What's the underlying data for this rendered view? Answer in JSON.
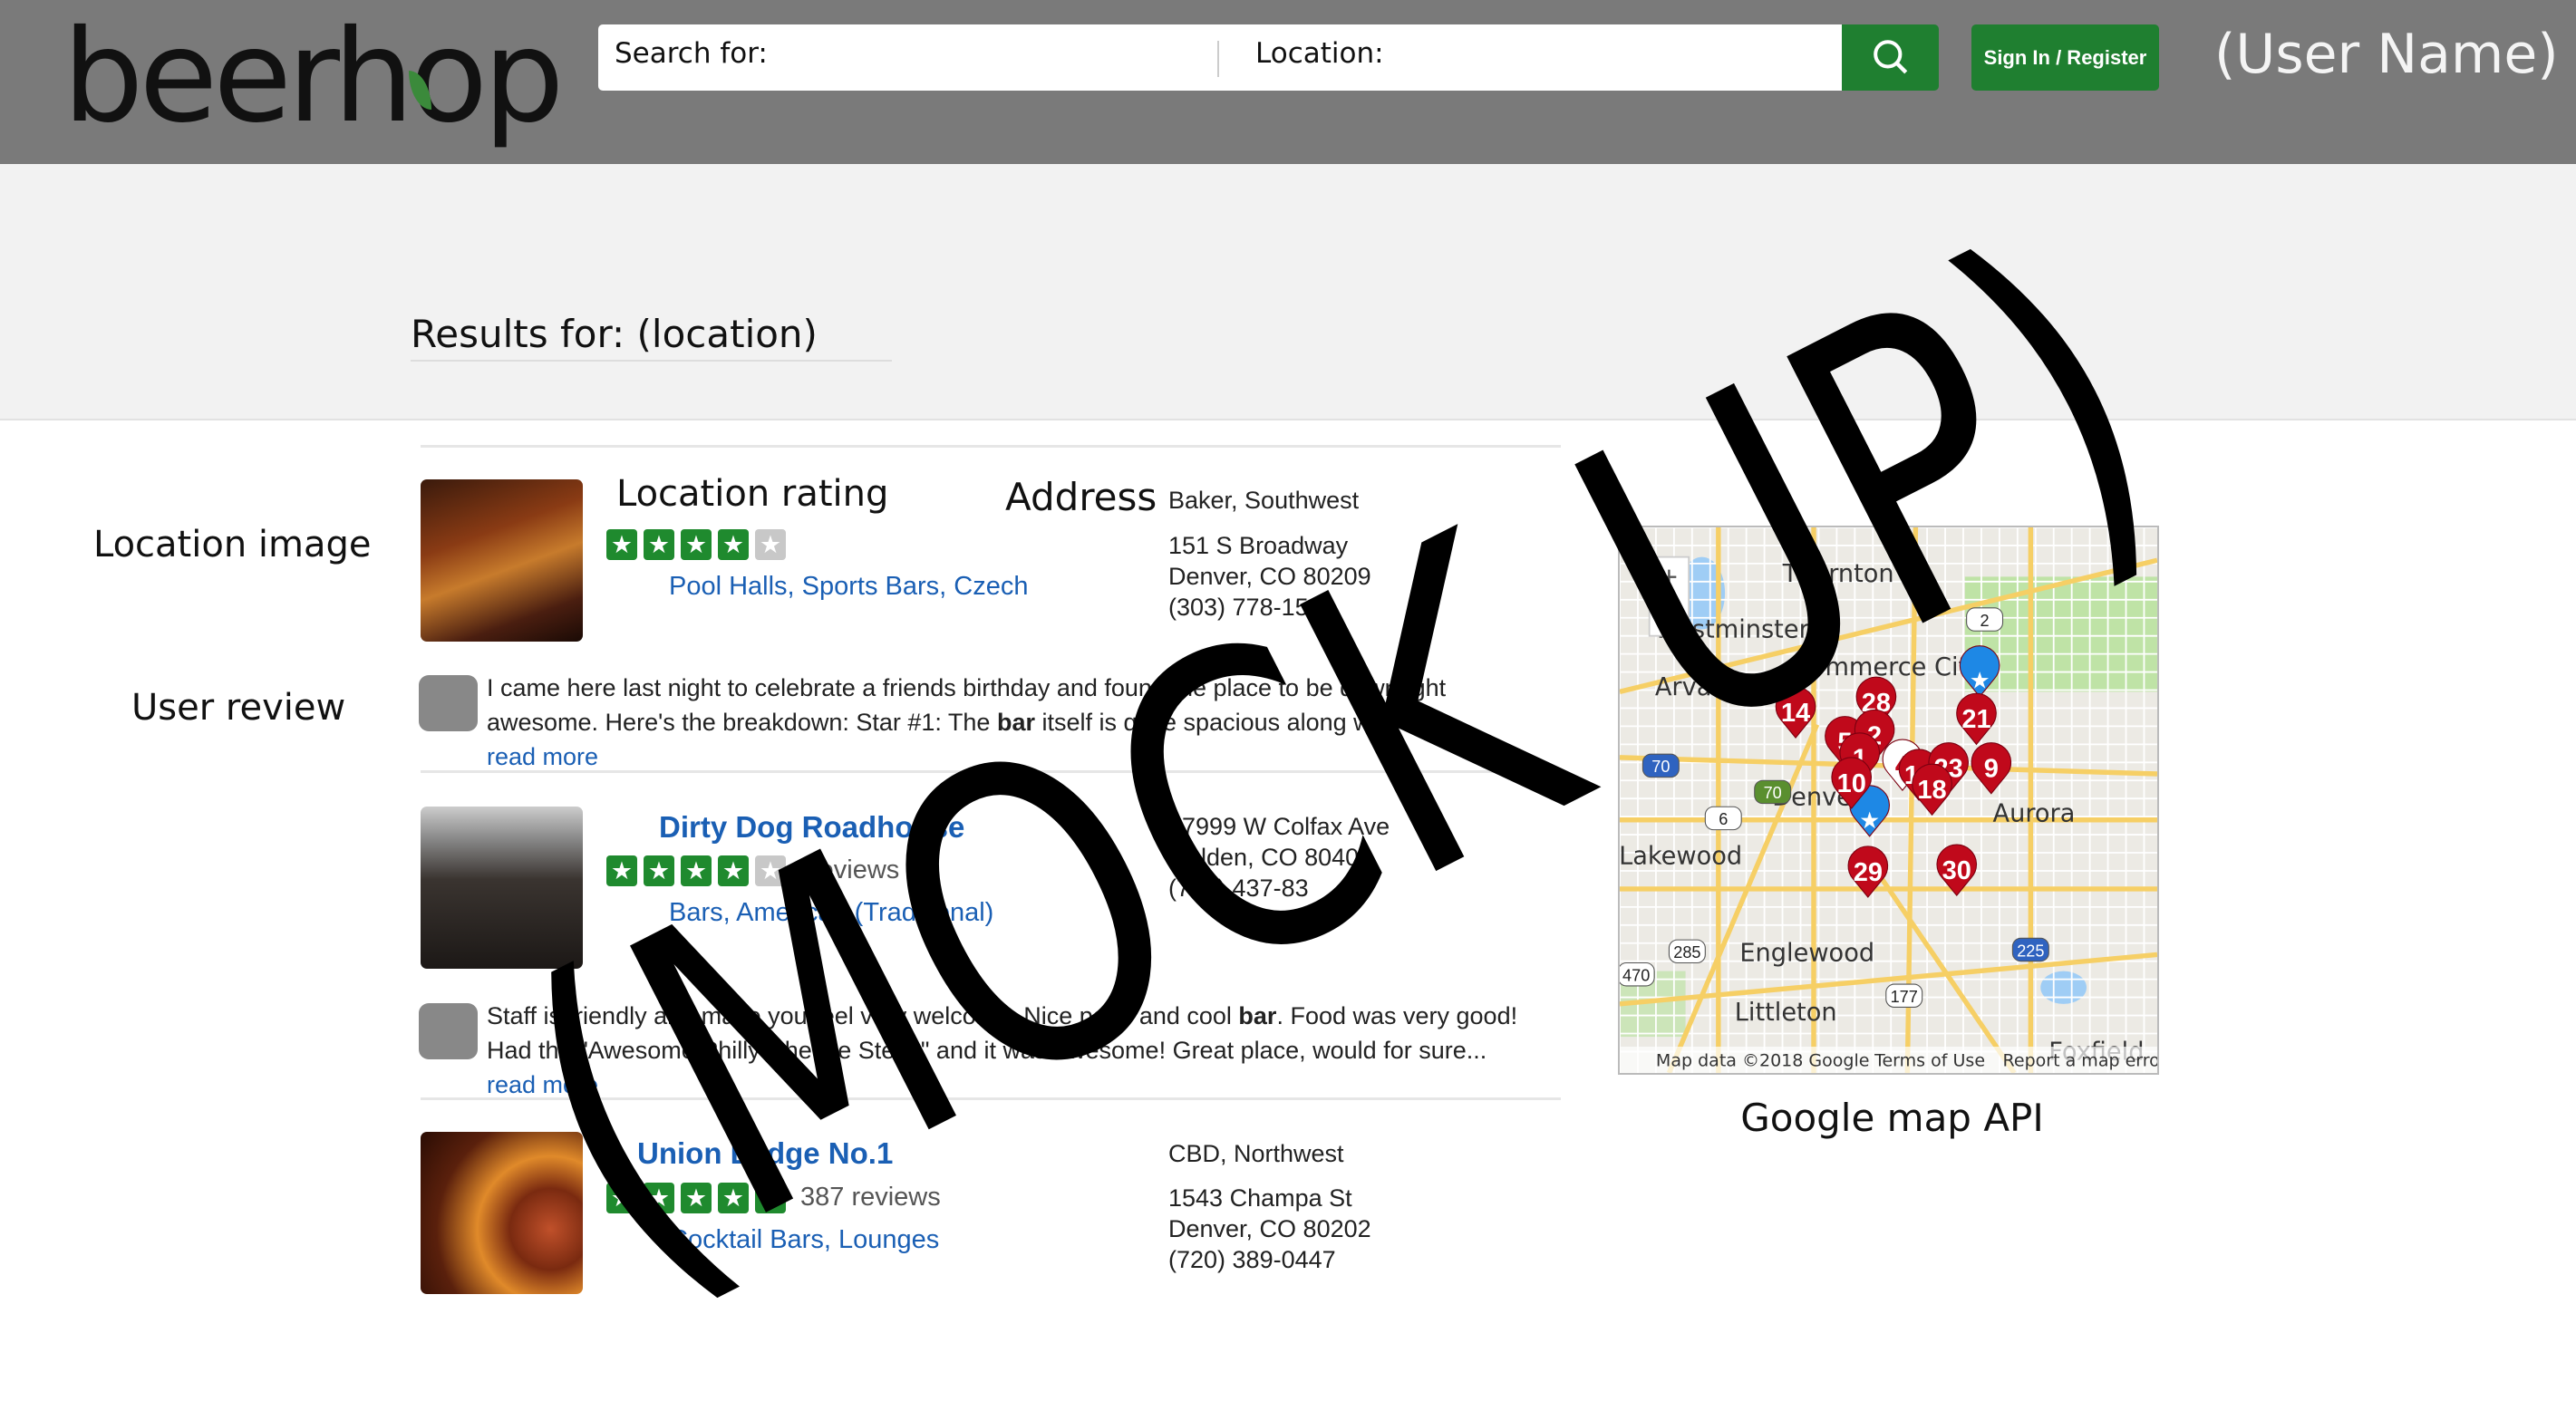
{
  "header": {
    "logo": "beerhop",
    "search_label": "Search for:",
    "location_label": "Location:",
    "search_icon": "search-icon",
    "signin_label": "Sign In / Register",
    "user_name": "(User Name)"
  },
  "results_title": "Results for: (location)",
  "annotations": {
    "location_image": "Location image",
    "user_review": "User review",
    "google_map": "Google map API",
    "watermark": "(MOCK UP)"
  },
  "listings": [
    {
      "title": "Location rating",
      "rating": 4,
      "categories": "Pool Halls, Sports Bars, Czech",
      "address_heading": "Address",
      "neighborhood": "Baker, Southwest",
      "address": [
        "151 S Broadway",
        "Denver, CO 80209",
        "(303) 778-1560"
      ],
      "review_pre": "I came here last night to celebrate a friends birthday and found the place to be downright awesome. Here's the breakdown: Star #1: The ",
      "review_bold": "bar",
      "review_post": " itself is quite spacious along with the...",
      "read_more": "read more"
    },
    {
      "title": "Dirty Dog Roadhouse",
      "rating": 4,
      "reviews": "reviews",
      "categories": "Bars, American (Traditional)",
      "address": [
        "17999 W Colfax Ave",
        "Golden, CO 80401",
        "(720) 437-83"
      ],
      "review_pre": "Staff is friendly and make you feel very welcome. Nice patio and cool ",
      "review_bold": "bar",
      "review_post": ". Food was very good! Had the \"Awesome Philly Cheese Steak\" and it was Awesome! Great place, would for sure...",
      "read_more": "read more"
    },
    {
      "title": "Union Lodge No.1",
      "rating": 5,
      "reviews": "387 reviews",
      "categories": "Cocktail Bars, Lounges",
      "neighborhood": "CBD, Northwest",
      "address": [
        "1543 Champa St",
        "Denver, CO 80202",
        "(720) 389-0447"
      ]
    }
  ],
  "map": {
    "places": [
      "Thornton",
      "Westminster",
      "Arvada",
      "Commerce City",
      "Denver",
      "Aurora",
      "Lakewood",
      "Englewood",
      "Littleton",
      "Foxfield"
    ],
    "pins": [
      "14",
      "28",
      "5",
      "2",
      "21",
      "1",
      "10",
      "4",
      "13",
      "23",
      "9",
      "18",
      "29",
      "30"
    ],
    "highways": [
      "2",
      "70",
      "70",
      "6",
      "285",
      "470",
      "225",
      "177"
    ],
    "footer": [
      "Map data ©2018 Google",
      "Terms of Use",
      "Report a map error"
    ],
    "zoom_in": "+",
    "colors": {
      "pin": "#c0091b",
      "star_pin": "#1e88e5",
      "road": "#f6cf65",
      "park": "#bfe3a6",
      "water": "#9fcdf5"
    }
  }
}
